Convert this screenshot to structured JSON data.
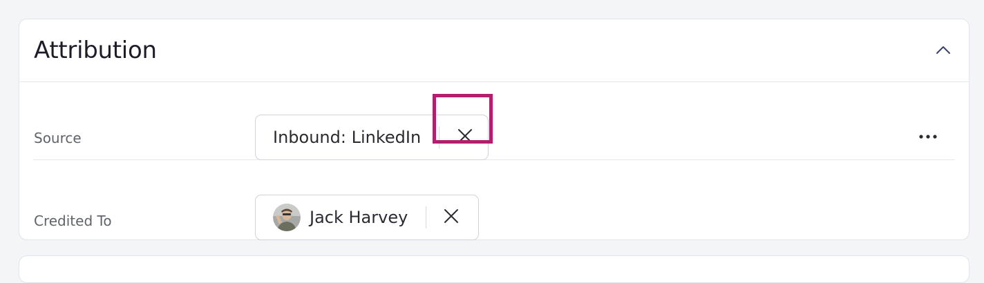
{
  "section": {
    "title": "Attribution",
    "collapse_icon": "chevron-up-icon"
  },
  "fields": {
    "source": {
      "label": "Source",
      "value": "Inbound: LinkedIn",
      "remove_icon": "close-icon",
      "more_icon": "more-horizontal-icon"
    },
    "credited_to": {
      "label": "Credited To",
      "value": "Jack Harvey",
      "avatar_icon": "user-avatar",
      "remove_icon": "close-icon"
    }
  },
  "colors": {
    "page_background": "#f3f5f7",
    "card_background": "#ffffff",
    "highlight": "#b41e6c",
    "chevron": "#3b3f6e"
  }
}
